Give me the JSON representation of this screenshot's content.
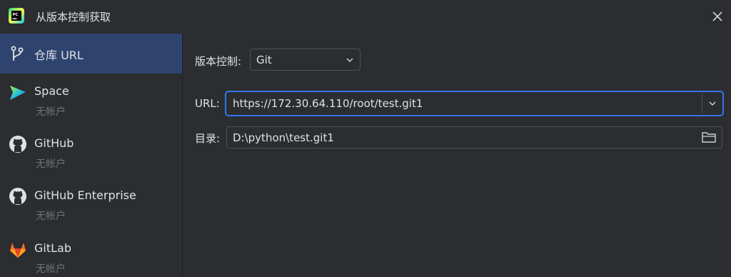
{
  "window": {
    "title": "从版本控制获取",
    "app_icon": "pycharm-icon",
    "close_icon": "close-icon"
  },
  "sidebar": {
    "items": [
      {
        "label": "仓库 URL",
        "icon": "vcs-branch-icon",
        "sub": "",
        "selected": true
      },
      {
        "label": "Space",
        "icon": "space-icon",
        "sub": "无帐户",
        "selected": false
      },
      {
        "label": "GitHub",
        "icon": "github-icon",
        "sub": "无帐户",
        "selected": false
      },
      {
        "label": "GitHub Enterprise",
        "icon": "github-icon",
        "sub": "无帐户",
        "selected": false
      },
      {
        "label": "GitLab",
        "icon": "gitlab-icon",
        "sub": "无帐户",
        "selected": false
      }
    ]
  },
  "form": {
    "vcs_label": "版本控制:",
    "vcs_value": "Git",
    "url_label": "URL:",
    "url_value": "https://172.30.64.110/root/test.git1",
    "dir_label": "目录:",
    "dir_value": "D:\\python\\test.git1"
  },
  "colors": {
    "background": "#2b2d30",
    "selection": "#2e436e",
    "focus_border": "#3574f0",
    "text": "#dfe1e5",
    "muted_text": "#6f737a"
  }
}
